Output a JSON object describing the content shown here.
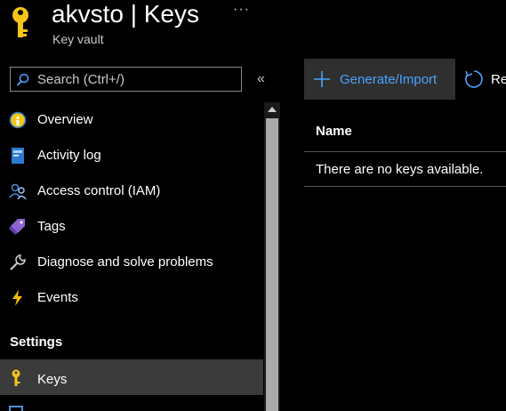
{
  "header": {
    "title": "akvsto | Keys",
    "subtitle": "Key vault",
    "more_label": "···"
  },
  "search": {
    "placeholder": "Search (Ctrl+/)",
    "collapse_label": "«"
  },
  "sidebar": {
    "items": [
      {
        "label": "Overview",
        "icon": "overview-icon"
      },
      {
        "label": "Activity log",
        "icon": "activity-log-icon"
      },
      {
        "label": "Access control (IAM)",
        "icon": "access-control-icon"
      },
      {
        "label": "Tags",
        "icon": "tag-icon"
      },
      {
        "label": "Diagnose and solve problems",
        "icon": "wrench-icon"
      },
      {
        "label": "Events",
        "icon": "lightning-icon"
      }
    ],
    "section_title": "Settings",
    "selected_item": {
      "label": "Keys",
      "icon": "key-icon"
    }
  },
  "toolbar": {
    "generate_label": "Generate/Import",
    "refresh_label": "Re"
  },
  "grid": {
    "column_name": "Name",
    "empty_message": "There are no keys available."
  },
  "colors": {
    "background": "#000000",
    "accent": "#4aa3ff",
    "key_yellow": "#f5c518",
    "selected_bg": "#3b3b3b"
  }
}
